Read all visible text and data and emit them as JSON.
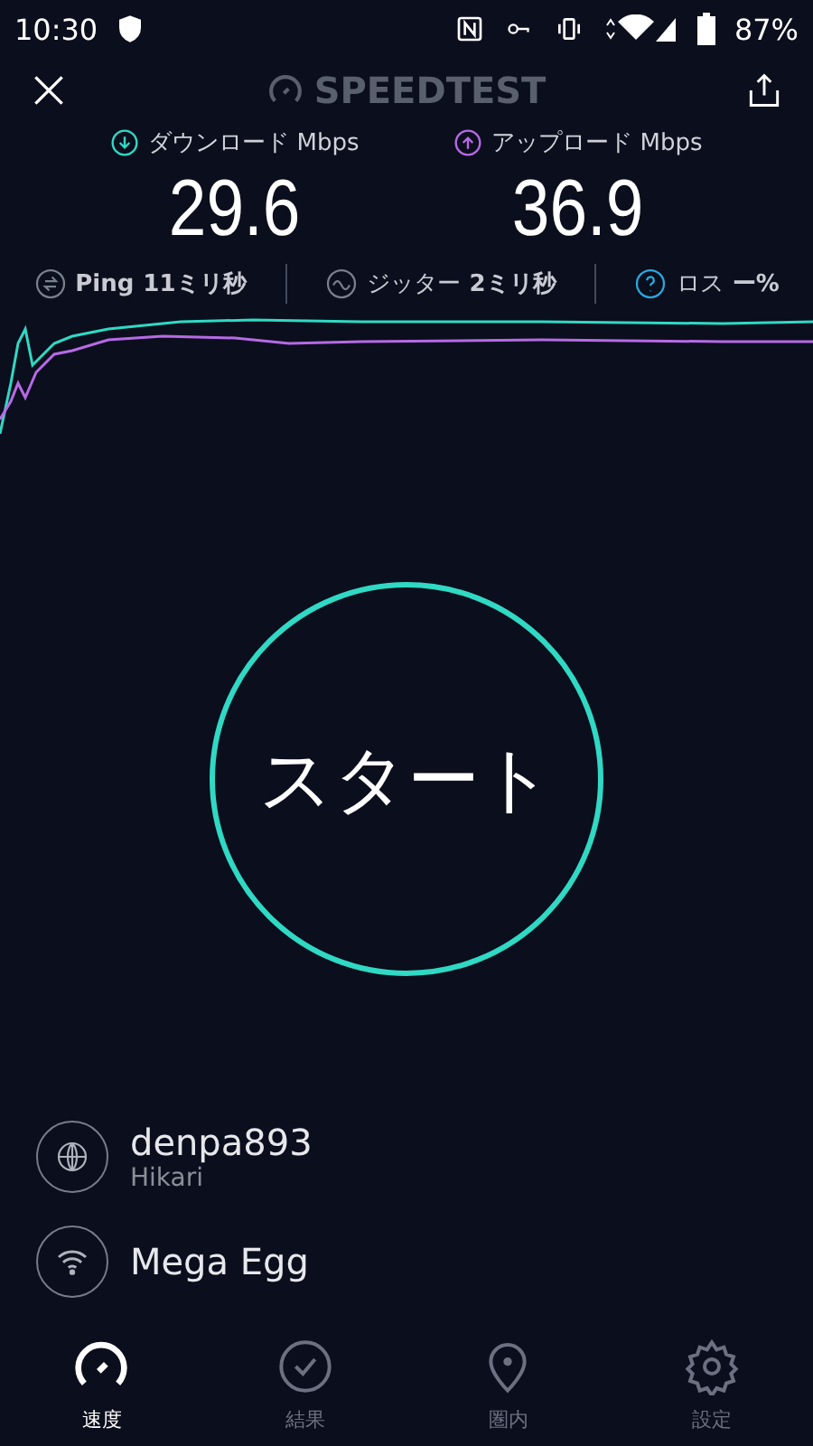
{
  "status_bar": {
    "time": "10:30",
    "battery": "87%"
  },
  "header": {
    "title": "SPEEDTEST"
  },
  "results": [
    {
      "kind": "download",
      "label": "ダウンロード Mbps",
      "value": "29.6"
    },
    {
      "kind": "upload",
      "label": "アップロード Mbps",
      "value": "36.9"
    }
  ],
  "stats": [
    {
      "kind": "ping",
      "label": "Ping",
      "value": "11ミリ秒"
    },
    {
      "kind": "jitter",
      "label": "ジッター",
      "value": "2ミリ秒"
    },
    {
      "kind": "loss",
      "label": "ロス",
      "value": "ー%"
    }
  ],
  "start_button": {
    "label": "スタート"
  },
  "connections": [
    {
      "kind": "host",
      "name": "denpa893",
      "detail": "Hikari"
    },
    {
      "kind": "wifi",
      "name": "Mega Egg"
    }
  ],
  "tabs": [
    {
      "kind": "speed",
      "label": "速度",
      "selected": true
    },
    {
      "kind": "results",
      "label": "結果",
      "selected": false
    },
    {
      "kind": "map",
      "label": "圏内",
      "selected": false
    },
    {
      "kind": "settings",
      "label": "設定",
      "selected": false
    }
  ]
}
